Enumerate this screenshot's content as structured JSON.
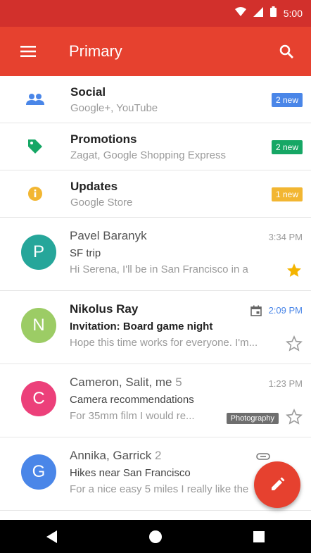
{
  "status_bar": {
    "time": "5:00"
  },
  "app_bar": {
    "title": "Primary"
  },
  "categories": [
    {
      "title": "Social",
      "subtitle": "Google+, YouTube",
      "badge": "2 new",
      "color": "#4a86e8",
      "icon": "people-icon"
    },
    {
      "title": "Promotions",
      "subtitle": "Zagat, Google Shopping Express",
      "badge": "2 new",
      "color": "#16a765",
      "icon": "tag-icon"
    },
    {
      "title": "Updates",
      "subtitle": "Google Store",
      "badge": "1 new",
      "color": "#f2b632",
      "icon": "info-icon"
    }
  ],
  "emails": [
    {
      "initial": "P",
      "avatar_color": "#26a69a",
      "sender": "Pavel Baranyk",
      "count": "",
      "subject": "SF trip",
      "snippet": "Hi Serena, I'll be in San Francisco in a",
      "time": "3:34 PM",
      "starred": true,
      "unread": false,
      "label": ""
    },
    {
      "initial": "N",
      "avatar_color": "#9ccc65",
      "sender": "Nikolus Ray",
      "count": "",
      "subject": "Invitation: Board game night",
      "snippet": "Hope this time works for everyone. I'm...",
      "time": "2:09 PM",
      "starred": false,
      "unread": true,
      "label": ""
    },
    {
      "initial": "C",
      "avatar_color": "#ec407a",
      "sender": "Cameron, Salit, me",
      "count": "5",
      "subject": "Camera recommendations",
      "snippet": "For 35mm film I would re...",
      "time": "1:23 PM",
      "starred": false,
      "unread": false,
      "label": "Photography"
    },
    {
      "initial": "G",
      "avatar_color": "#4a86e8",
      "sender": "Annika, Garrick",
      "count": "2",
      "subject": "Hikes near San Francisco",
      "snippet": "For a nice easy 5 miles I really like the",
      "time": "",
      "starred": false,
      "unread": false,
      "label": ""
    }
  ],
  "colors": {
    "status_bar": "#d2302c",
    "app_bar": "#e6412f",
    "fab": "#e6412f",
    "star": "#f4b400"
  }
}
